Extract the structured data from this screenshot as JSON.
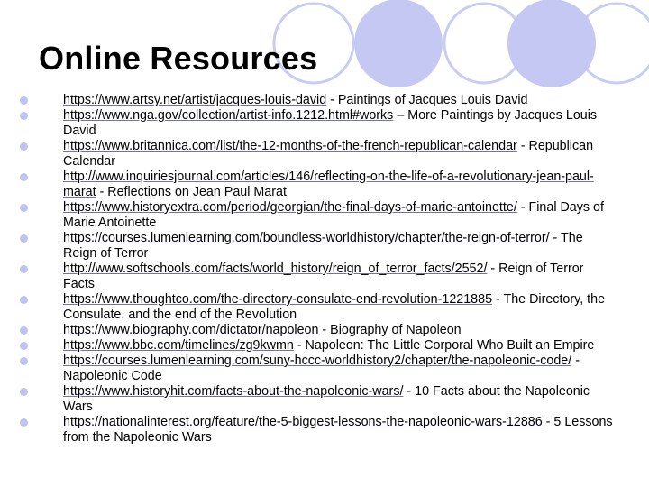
{
  "slide": {
    "title": "Online Resources",
    "accent_color": "#c5c8f2",
    "accent_dark": "#b6b9ee"
  },
  "resources": [
    {
      "url": "https://www.artsy.net/artist/jacques-louis-david",
      "desc": " - Paintings of Jacques Louis David"
    },
    {
      "url": "https://www.nga.gov/collection/artist-info.1212.html#works",
      "desc": " – More Paintings by Jacques Louis David"
    },
    {
      "url": "https://www.britannica.com/list/the-12-months-of-the-french-republican-calendar",
      "desc": " - Republican Calendar"
    },
    {
      "url": "http://www.inquiriesjournal.com/articles/146/reflecting-on-the-life-of-a-revolutionary-jean-paul-marat",
      "desc": " - Reflections on Jean Paul Marat"
    },
    {
      "url": "https://www.historyextra.com/period/georgian/the-final-days-of-marie-antoinette/",
      "desc": " - Final Days of Marie Antoinette"
    },
    {
      "url": "https://courses.lumenlearning.com/boundless-worldhistory/chapter/the-reign-of-terror/",
      "desc": " - The Reign of Terror"
    },
    {
      "url": "http://www.softschools.com/facts/world_history/reign_of_terror_facts/2552/",
      "desc": " - Reign of Terror Facts"
    },
    {
      "url": "https://www.thoughtco.com/the-directory-consulate-end-revolution-1221885",
      "desc": " - The Directory, the Consulate, and the end of the Revolution"
    },
    {
      "url": "https://www.biography.com/dictator/napoleon",
      "desc": " - Biography of Napoleon"
    },
    {
      "url": "https://www.bbc.com/timelines/zg9kwmn",
      "desc": " - Napoleon: The Little Corporal Who Built an Empire"
    },
    {
      "url": "https://courses.lumenlearning.com/suny-hccc-worldhistory2/chapter/the-napoleonic-code/",
      "desc": " - Napoleonic Code"
    },
    {
      "url": "https://www.historyhit.com/facts-about-the-napoleonic-wars/",
      "desc": " - 10 Facts about the Napoleonic Wars"
    },
    {
      "url": "https://nationalinterest.org/feature/the-5-biggest-lessons-the-napoleonic-wars-12886",
      "desc": " - 5 Lessons from the Napoleonic Wars"
    }
  ]
}
